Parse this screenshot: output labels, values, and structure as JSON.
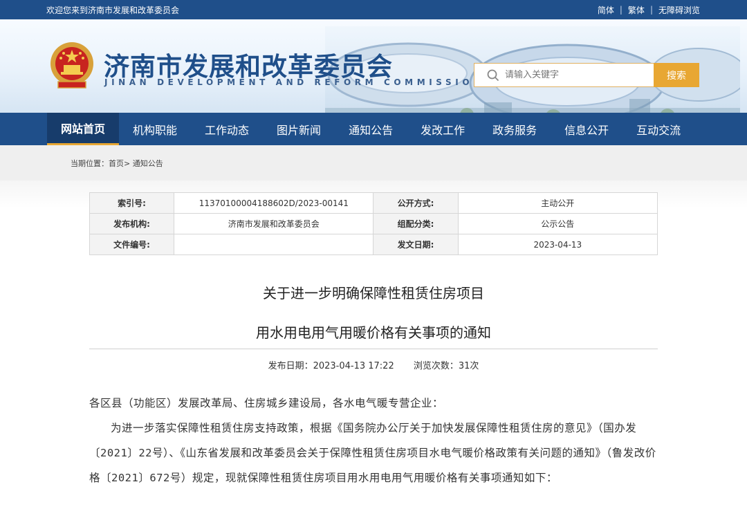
{
  "topbar": {
    "welcome": "欢迎您来到济南市发展和改革委员会",
    "links": [
      "简体",
      "繁体",
      "无障碍浏览"
    ],
    "separator": "|"
  },
  "header": {
    "title": "济南市发展和改革委员会",
    "subtitle": "JINAN DEVELOPMENT AND REFORM COMMISSION",
    "search_placeholder": "请输入关键字",
    "search_button": "搜索"
  },
  "nav": {
    "items": [
      "网站首页",
      "机构职能",
      "工作动态",
      "图片新闻",
      "通知公告",
      "发改工作",
      "政务服务",
      "信息公开",
      "互动交流"
    ]
  },
  "breadcrumb": {
    "text": "当期位置：首页> 通知公告"
  },
  "meta": {
    "index_label": "索引号:",
    "index_value": "11370100004188602D/2023-00141",
    "open_label": "公开方式:",
    "open_value": "主动公开",
    "publisher_label": "发布机构:",
    "publisher_value": "济南市发展和改革委员会",
    "category_label": "组配分类:",
    "category_value": "公示公告",
    "docno_label": "文件编号:",
    "docno_value": "",
    "date_label": "发文日期:",
    "date_value": "2023-04-13"
  },
  "article": {
    "title_line1": "关于进一步明确保障性租赁住房项目",
    "title_line2": "用水用电用气用暖价格有关事项的通知",
    "publish_date": "发布日期：2023-04-13 17:22",
    "view_count": "浏览次数：31次",
    "salutation": "各区县（功能区）发展改革局、住房城乡建设局，各水电气暖专营企业：",
    "paragraph1": "为进一步落实保障性租赁住房支持政策，根据《国务院办公厅关于加快发展保障性租赁住房的意见》（国办发〔2021〕22号）、《山东省发展和改革委员会关于保障性租赁住房项目水电气暖价格政策有关问题的通知》（鲁发改价格〔2021〕672号）规定，现就保障性租赁住房项目用水用电用气用暖价格有关事项通知如下："
  },
  "colors": {
    "primary": "#1f4f8a",
    "accent": "#e8a733"
  }
}
